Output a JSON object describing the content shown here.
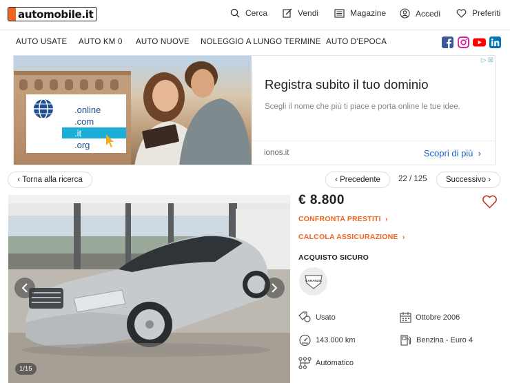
{
  "header": {
    "logo_text": "automobile.it",
    "nav": [
      {
        "label": "Cerca",
        "icon": "search-icon"
      },
      {
        "label": "Vendi",
        "icon": "edit-icon"
      },
      {
        "label": "Magazine",
        "icon": "newspaper-icon"
      },
      {
        "label": "Accedi",
        "icon": "user-icon"
      },
      {
        "label": "Preferiti",
        "icon": "heart-icon"
      }
    ]
  },
  "categories": [
    "AUTO USATE",
    "AUTO KM 0",
    "AUTO NUOVE",
    "NOLEGGIO A LUNGO TERMINE",
    "AUTO D'EPOCA"
  ],
  "social": [
    {
      "icon": "facebook-icon",
      "color": "#3b5998"
    },
    {
      "icon": "instagram-icon",
      "color": "#d6249f"
    },
    {
      "icon": "youtube-icon",
      "color": "#ff0000"
    },
    {
      "icon": "linkedin-icon",
      "color": "#0077b5"
    }
  ],
  "ad": {
    "domains": [
      ".online",
      ".com",
      ".it",
      ".org"
    ],
    "title": "Registra subito il tuo dominio",
    "description": "Scegli il nome che più ti piace e porta online le tue idee.",
    "source": "ionos.it",
    "cta": "Scopri di più"
  },
  "navigation": {
    "back": "Torna alla ricerca",
    "prev": "Precedente",
    "counter": "22 / 125",
    "next": "Successivo"
  },
  "gallery": {
    "counter": "1/15"
  },
  "listing": {
    "price": "€ 8.800",
    "financing": "CONFRONTA PRESTITI",
    "insurance": "CALCOLA ASSICURAZIONE",
    "secure_label": "ACQUISTO SICURO",
    "badge_text": "GARANZIA",
    "specs": {
      "condition": "Usato",
      "date": "Ottobre 2006",
      "mileage": "143.000 km",
      "fuel": "Benzina - Euro 4",
      "transmission": "Automatico"
    }
  },
  "colors": {
    "accent": "#f0641e",
    "link": "#1a5fc7"
  }
}
